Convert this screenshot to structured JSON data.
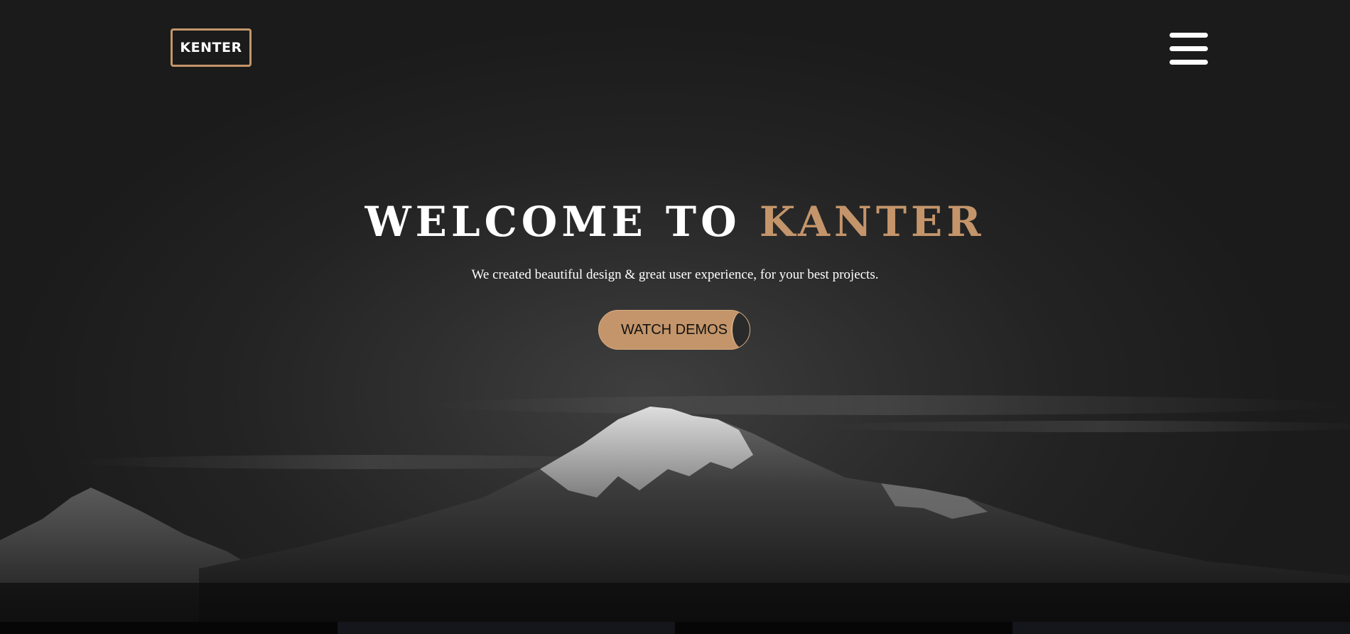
{
  "logo": {
    "text": "KENTER"
  },
  "menu": {
    "icon": "hamburger-menu-icon"
  },
  "hero": {
    "title_part1": "WELCOME TO ",
    "title_part2": "KANTER",
    "subtitle": "We created beautiful design & great user experience, for your best projects.",
    "cta_label": "WATCH DEMOS"
  },
  "colors": {
    "accent": "#c4956a",
    "background": "#1f1f1f",
    "text": "#ffffff"
  }
}
